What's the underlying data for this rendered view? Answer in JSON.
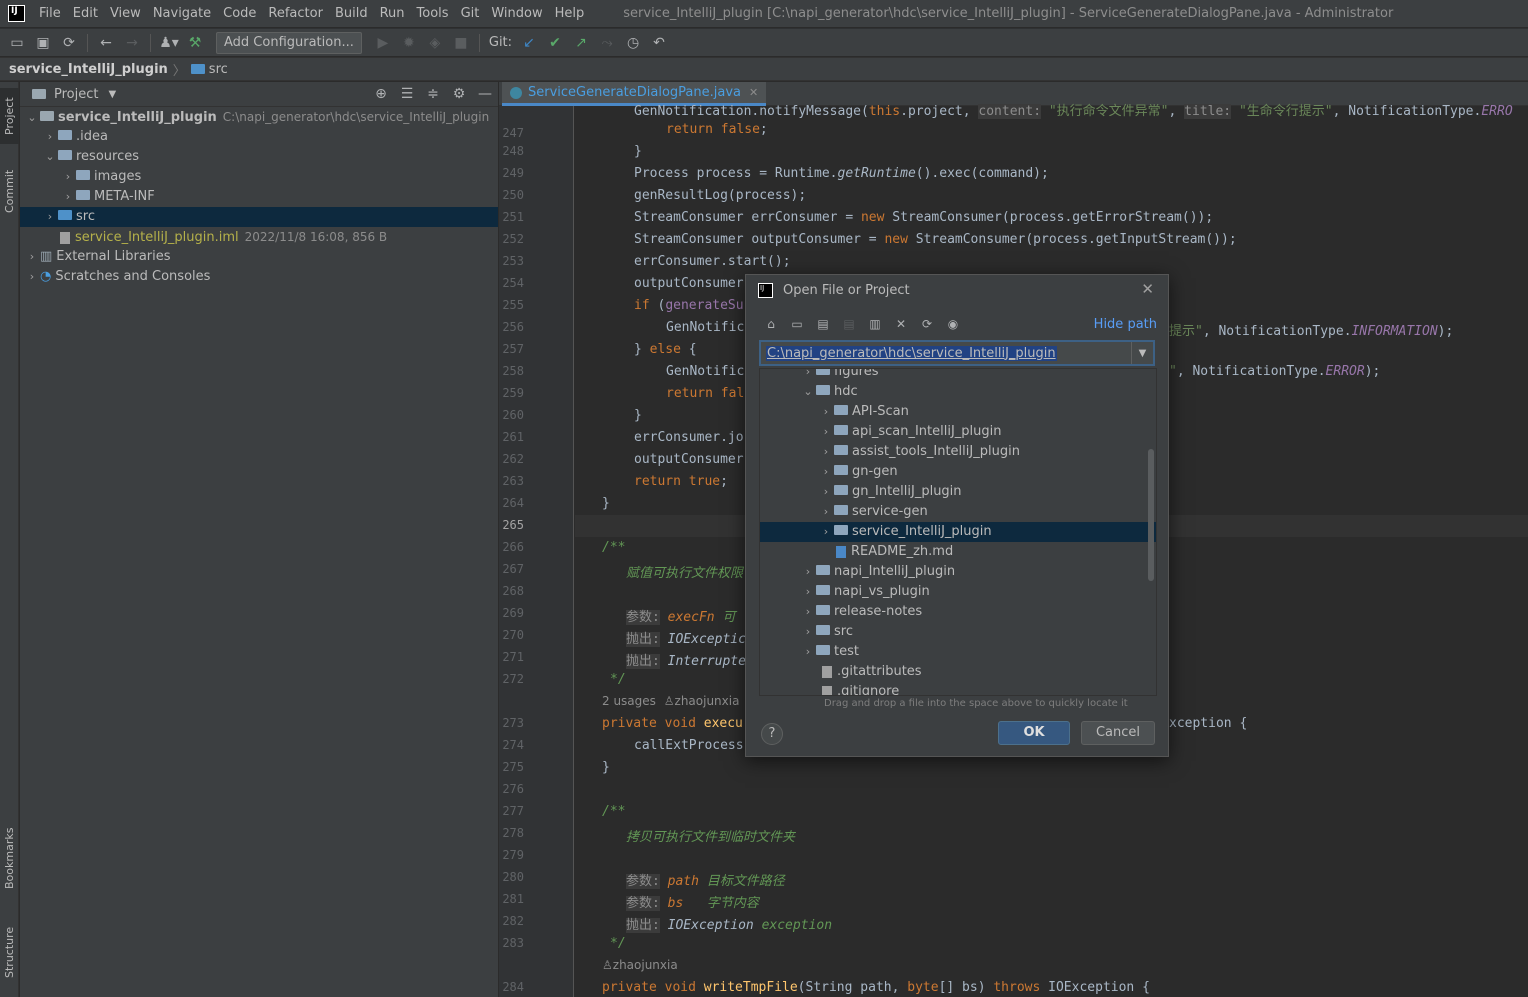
{
  "menubar": {
    "logo": "IJ",
    "items": [
      "File",
      "Edit",
      "View",
      "Navigate",
      "Code",
      "Refactor",
      "Build",
      "Run",
      "Tools",
      "Git",
      "Window",
      "Help"
    ],
    "window_title": "service_IntelliJ_plugin [C:\\napi_generator\\hdc\\service_IntelliJ_plugin] - ServiceGenerateDialogPane.java - Administrator"
  },
  "toolbar": {
    "add_configuration": "Add Configuration...",
    "git_label": "Git:"
  },
  "breadcrumb": {
    "project": "service_IntelliJ_plugin",
    "folder": "src"
  },
  "left_stripe": {
    "project": "Project",
    "commit": "Commit",
    "bookmarks": "Bookmarks",
    "structure": "Structure"
  },
  "project_panel": {
    "title": "Project",
    "tree": [
      {
        "label": "service_IntelliJ_plugin",
        "hint": "C:\\napi_generator\\hdc\\service_IntelliJ_plugin"
      },
      {
        "label": ".idea"
      },
      {
        "label": "resources"
      },
      {
        "label": "images"
      },
      {
        "label": "META-INF"
      },
      {
        "label": "src"
      },
      {
        "label": "service_IntelliJ_plugin.iml",
        "hint": "2022/11/8 16:08, 856 B"
      },
      {
        "label": "External Libraries"
      },
      {
        "label": "Scratches and Consoles"
      }
    ]
  },
  "editor": {
    "tab": "ServiceGenerateDialogPane.java",
    "line_numbers": [
      "247",
      "248",
      "249",
      "250",
      "251",
      "252",
      "253",
      "254",
      "255",
      "256",
      "257",
      "258",
      "259",
      "260",
      "261",
      "262",
      "263",
      "264",
      "265",
      "266",
      "267",
      "268",
      "269",
      "270",
      "271",
      "272",
      "273",
      "274",
      "275",
      "276",
      "277",
      "278",
      "279",
      "280",
      "281",
      "282",
      "283",
      "284"
    ],
    "usages_hint": "2 usages",
    "author_hint": "zhaojunxia",
    "author_hint2": "zhaojunxia",
    "comment_exec_perm": "赋值可执行文件权限",
    "param_label": "参数:",
    "throws_label": "抛出:",
    "comment_copy": "拷贝可执行文件到临时文件夹",
    "param_path_desc": "目标文件路径",
    "param_bs_desc": "字节内容",
    "inlay_content": "content:",
    "inlay_title": "title:",
    "str_exec_fail": "\"执行命令文件异常\"",
    "str_cmd_hint": "\"生命令行提示\"",
    "str_hint_tail": "提示\"",
    "notif_info": "INFORMATION",
    "notif_error": "ERROR",
    "notif_error2": "ERRO"
  },
  "dialog": {
    "title": "Open File or Project",
    "hide_path": "Hide path",
    "path_value": "C:\\napi_generator\\hdc\\service_IntelliJ_plugin",
    "tree": [
      {
        "label": "figures"
      },
      {
        "label": "hdc"
      },
      {
        "label": "API-Scan"
      },
      {
        "label": "api_scan_IntelliJ_plugin"
      },
      {
        "label": "assist_tools_IntelliJ_plugin"
      },
      {
        "label": "gn-gen"
      },
      {
        "label": "gn_IntelliJ_plugin"
      },
      {
        "label": "service-gen"
      },
      {
        "label": "service_IntelliJ_plugin"
      },
      {
        "label": "README_zh.md"
      },
      {
        "label": "napi_IntelliJ_plugin"
      },
      {
        "label": "napi_vs_plugin"
      },
      {
        "label": "release-notes"
      },
      {
        "label": "src"
      },
      {
        "label": "test"
      },
      {
        "label": ".gitattributes"
      },
      {
        "label": ".gitignore"
      }
    ],
    "drag_hint": "Drag and drop a file into the space above to quickly locate it",
    "help": "?",
    "ok": "OK",
    "cancel": "Cancel"
  },
  "colors": {
    "background": "#2b2b2b",
    "panel": "#3c3f41",
    "selection": "#0d293e",
    "keyword": "#cc7832",
    "accent": "#4a88c7",
    "ok_button": "#365880"
  }
}
